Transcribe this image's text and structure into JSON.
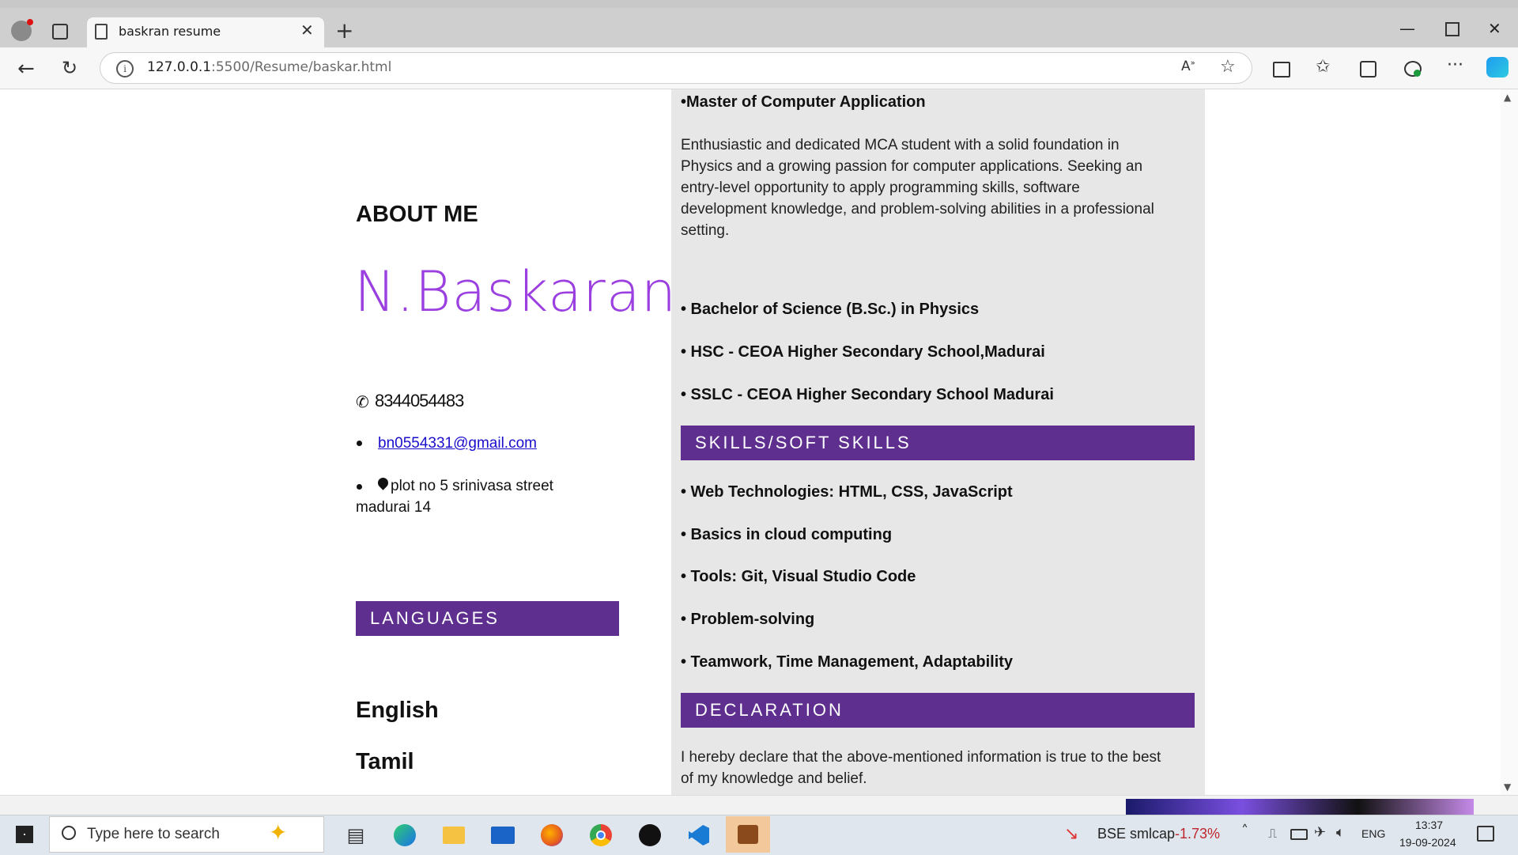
{
  "browser": {
    "tab_title": "baskran resume",
    "url_host": "127.0.0.1",
    "url_rest": ":5500/Resume/baskar.html",
    "icons": [
      "profile-icon",
      "tab-actions-icon",
      "page-icon",
      "close-icon",
      "new-tab-icon",
      "minimize-icon",
      "maximize-icon",
      "window-close-icon",
      "back-icon",
      "reload-icon",
      "info-icon",
      "read-aloud-icon",
      "favorite-icon",
      "split-screen-icon",
      "favorites-icon",
      "collections-icon",
      "performance-icon",
      "more-icon",
      "copilot-icon"
    ]
  },
  "resume": {
    "about_heading": "ABOUT ME",
    "name": "N.Baskaran",
    "phone": "8344054483",
    "email": "bn0554331@gmail.com",
    "address_line1": "plot no 5 srinivasa street",
    "address_line2": "madurai 14",
    "languages_heading": "LANGUAGES",
    "languages": [
      "English",
      "Tamil"
    ],
    "degree": "•Master of Computer Application",
    "summary_lines": [
      "Enthusiastic and dedicated MCA student with a solid foundation in",
      "Physics and a growing passion for computer applications. Seeking an",
      "entry-level opportunity to apply programming skills, software",
      "development knowledge, and problem-solving abilities in a professional",
      "setting."
    ],
    "education": [
      "• Bachelor of Science (B.Sc.) in Physics",
      "• HSC - CEOA Higher Secondary School,Madurai",
      "• SSLC - CEOA Higher Secondary School Madurai"
    ],
    "skills_heading": "SKILLS/SOFT SKILLS",
    "skills": [
      "• Web Technologies: HTML, CSS, JavaScript",
      "• Basics in cloud computing",
      "• Tools: Git, Visual Studio Code",
      "• Problem-solving",
      "• Teamwork, Time Management, Adaptability"
    ],
    "declaration_heading": "DECLARATION",
    "declaration_lines": [
      "I hereby declare that the above-mentioned information is true to the best",
      "of my knowledge and belief."
    ],
    "accent_color": "#5e2f8f",
    "name_color": "#9b3fe0"
  },
  "taskbar": {
    "search_placeholder": "Type here to search",
    "stock_label": "BSE smlcap",
    "stock_change": "-1.73%",
    "language": "ENG",
    "time": "13:37",
    "date": "19-09-2024",
    "apps": [
      "start-icon",
      "task-view-icon",
      "edge-icon",
      "file-explorer-icon",
      "mail-icon",
      "firefox-icon",
      "chrome-icon",
      "github-icon",
      "vscode-icon",
      "winrar-icon"
    ]
  }
}
